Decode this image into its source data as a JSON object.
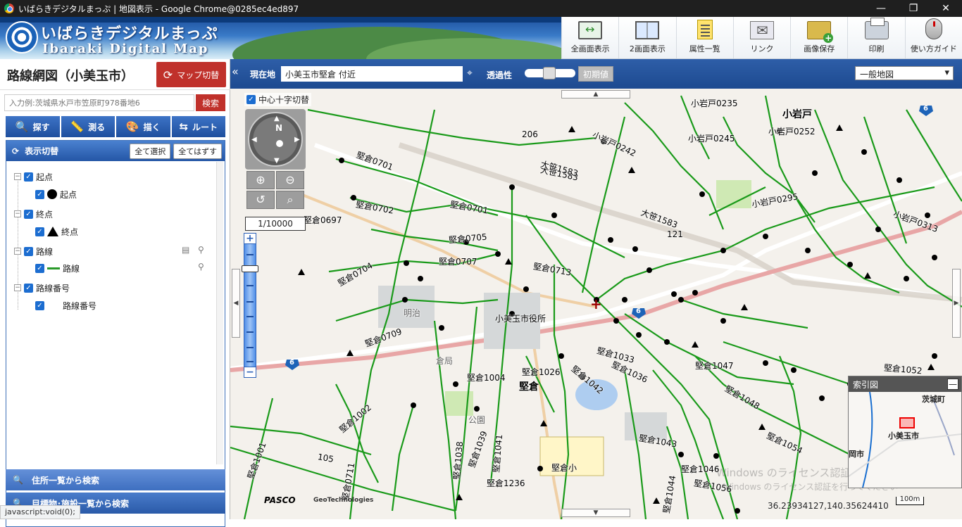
{
  "browser": {
    "window_title": "いばらきデジタルまっぷ | 地図表示 - Google Chrome@0285ec4ed897",
    "minimize": "—",
    "restore": "❐",
    "close": "✕",
    "status_url": "javascript:void(0);"
  },
  "header": {
    "logo_jp": "いばらきデジタルまっぷ",
    "logo_en": "Ibaraki Digital Map",
    "tools": [
      {
        "label": "全画面表示",
        "icon": "fullscreen-icon"
      },
      {
        "label": "2画面表示",
        "icon": "dual-screen-icon"
      },
      {
        "label": "属性一覧",
        "icon": "attribute-list-icon"
      },
      {
        "label": "リンク",
        "icon": "link-mail-icon"
      },
      {
        "label": "画像保存",
        "icon": "save-image-icon"
      },
      {
        "label": "印刷",
        "icon": "print-icon"
      },
      {
        "label": "使い方ガイド",
        "icon": "guide-mouse-icon"
      }
    ]
  },
  "left_panel": {
    "title": "路線網図（小美玉市）",
    "map_switch": "マップ切替",
    "search_placeholder": "入力例:茨城県水戸市笠原町978番地6",
    "search_button": "検索",
    "tabs": [
      {
        "label": "探す",
        "icon": "search-icon"
      },
      {
        "label": "測る",
        "icon": "ruler-icon"
      },
      {
        "label": "描く",
        "icon": "palette-icon"
      },
      {
        "label": "ルート",
        "icon": "route-icon"
      }
    ],
    "layer_header": "表示切替",
    "select_all": "全て選択",
    "deselect_all": "全てはずす",
    "layers": [
      {
        "group": "起点",
        "item": "起点"
      },
      {
        "group": "終点",
        "item": "終点"
      },
      {
        "group": "路線",
        "item": "路線"
      },
      {
        "group": "路線番号",
        "item": "路線番号"
      }
    ],
    "accordion_address": "住所一覧から検索",
    "accordion_landmark": "目標物･施設一覧から検索"
  },
  "mapbar": {
    "location_label": "現在地",
    "location_value": "小美玉市堅倉 付近",
    "transparency_label": "透過性",
    "reset_label": "初期値",
    "basemap": "一般地図"
  },
  "map": {
    "crosshair_label": "中心十字切替",
    "compass_n": "N",
    "scale": "1/10000",
    "coordinates": "36.23934127,140.35624410",
    "scale_bar": "100m",
    "credit_pasco": "PASCO",
    "credit_geo": "GeoTechnologies",
    "watermark": "Windows のライセンス認証",
    "watermark_sub": "Windows のライセンス認証を行ってください",
    "index_title": "索引図",
    "index_close": "—",
    "index_labels": [
      "茨城町",
      "小美玉市",
      "岡市"
    ],
    "area_labels": [
      "小岩戸",
      "堅倉",
      "堅倉小",
      "明治",
      "小美玉市役所",
      "倉局",
      "公園"
    ],
    "road_labels": [
      "206",
      "大笹1583",
      "大笹1583",
      "121",
      "105",
      "小岩戸0252",
      "小岩戸0245",
      "小岩戸0242",
      "堅倉0701",
      "堅倉0702",
      "堅倉0701",
      "堅倉0704",
      "堅倉0705",
      "堅倉0707",
      "堅倉0709",
      "堅倉0697",
      "堅倉1004",
      "堅倉1026",
      "堅倉1033",
      "堅倉1036",
      "堅倉1042",
      "堅倉1043",
      "堅倉1054",
      "堅倉1052",
      "堅倉1056",
      "堅倉1236",
      "小岩戸0235",
      "大笹1583",
      "小岩戸0295",
      "小岩戸0313",
      "堅倉1048",
      "堅倉1047",
      "堅倉1046",
      "堅倉1044",
      "堅倉1039",
      "堅倉1038",
      "堅倉1041",
      "堅倉1002",
      "堅倉1001",
      "堅倉0711",
      "堅倉0713"
    ],
    "route_badges": [
      "6",
      "6",
      "6",
      "6"
    ],
    "accent_route": "#1a9a1a",
    "accent_header": "#2456a6",
    "accent_red": "#c0312b"
  }
}
